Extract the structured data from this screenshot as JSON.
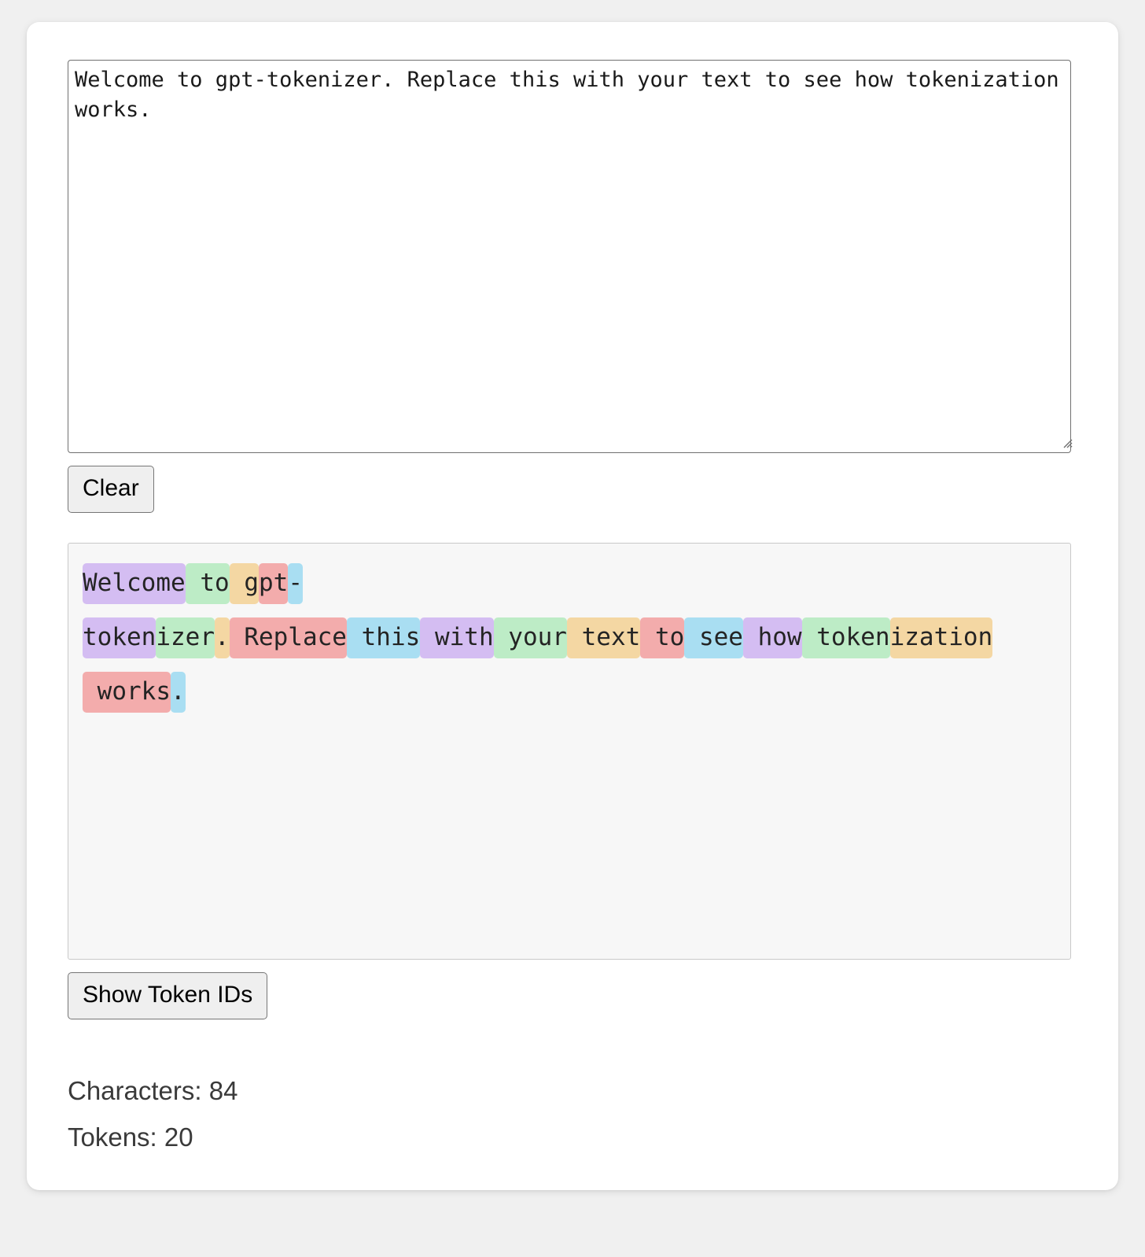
{
  "app": {
    "page_background": "#f0f0f0",
    "card_background": "#ffffff"
  },
  "input": {
    "value": "Welcome to gpt-tokenizer. Replace this with your text to see how tokenization works.",
    "placeholder": "Replace this with your text to see how tokenization works."
  },
  "buttons": {
    "clear_label": "Clear",
    "show_token_ids_label": "Show Token IDs"
  },
  "token_palette": {
    "purple": "#d4bdf2",
    "green": "#bdecc6",
    "orange": "#f4d7a3",
    "red": "#f3acac",
    "blue": "#a9def2"
  },
  "tokens": [
    {
      "text": "Welcome",
      "color": "#d4bdf2"
    },
    {
      "text": " to",
      "color": "#bdecc6"
    },
    {
      "text": " g",
      "color": "#f4d7a3"
    },
    {
      "text": "pt",
      "color": "#f3acac"
    },
    {
      "text": "-",
      "color": "#a9def2"
    },
    {
      "text": "token",
      "color": "#d4bdf2"
    },
    {
      "text": "izer",
      "color": "#bdecc6"
    },
    {
      "text": ".",
      "color": "#f4d7a3"
    },
    {
      "text": " Replace",
      "color": "#f3acac"
    },
    {
      "text": " this",
      "color": "#a9def2"
    },
    {
      "text": " with",
      "color": "#d4bdf2"
    },
    {
      "text": " your",
      "color": "#bdecc6"
    },
    {
      "text": " text",
      "color": "#f4d7a3"
    },
    {
      "text": " to",
      "color": "#f3acac"
    },
    {
      "text": " see",
      "color": "#a9def2"
    },
    {
      "text": " how",
      "color": "#d4bdf2"
    },
    {
      "text": " token",
      "color": "#bdecc6"
    },
    {
      "text": "ization",
      "color": "#f4d7a3"
    },
    {
      "text": " works",
      "color": "#f3acac"
    },
    {
      "text": ".",
      "color": "#a9def2"
    }
  ],
  "stats": {
    "characters_line": "Characters: 84",
    "tokens_line": "Tokens: 20",
    "characters_count": 84,
    "tokens_count": 20
  }
}
